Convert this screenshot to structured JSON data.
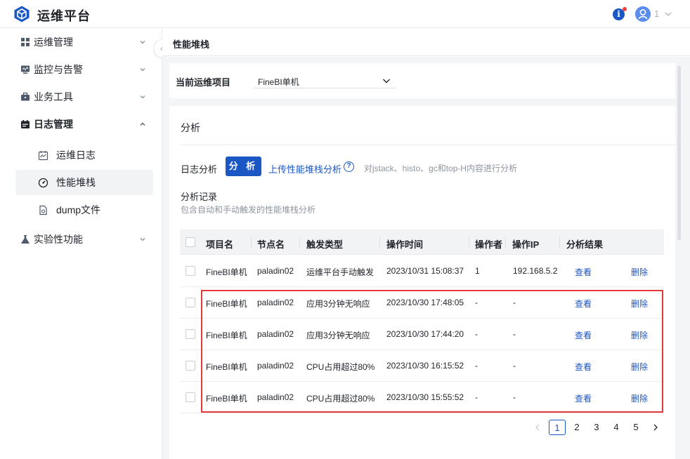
{
  "header": {
    "app_title": "运维平台",
    "logo_icon": "cube-logo-icon",
    "user_name": "1",
    "accent": "#1a56c4",
    "notification_color": "#f53f3f"
  },
  "sidebar": {
    "items": [
      {
        "label": "运维管理",
        "icon": "grid-icon",
        "expanded": false
      },
      {
        "label": "监控与告警",
        "icon": "monitor-icon",
        "expanded": false
      },
      {
        "label": "业务工具",
        "icon": "briefcase-icon",
        "expanded": false
      },
      {
        "label": "日志管理",
        "icon": "calendar-icon",
        "expanded": true,
        "children": [
          {
            "label": "运维日志",
            "icon": "log-chart-icon"
          },
          {
            "label": "性能堆栈",
            "icon": "gauge-icon",
            "active": true
          },
          {
            "label": "dump文件",
            "icon": "file-gear-icon"
          }
        ]
      },
      {
        "label": "实验性功能",
        "icon": "flask-icon",
        "expanded": false
      }
    ]
  },
  "breadcrumb": "性能堆栈",
  "project": {
    "label": "当前运维项目",
    "value": "FineBI单机"
  },
  "analysis": {
    "section_title": "分析",
    "log_label": "日志分析",
    "analyze_button": "分 析",
    "upload_link": "上传性能堆栈分析",
    "help_text": "对jstack、histo、gc和top-H内容进行分析",
    "records_title": "分析记录",
    "records_desc": "包含自动和手动触发的性能堆栈分析"
  },
  "table": {
    "columns": [
      "项目名",
      "节点名",
      "触发类型",
      "操作时间",
      "操作者",
      "操作IP",
      "分析结果"
    ],
    "rows": [
      {
        "project": "FineBI单机",
        "node": "paladin02",
        "trigger": "运维平台手动触发",
        "time": "2023/10/31 15:08:37",
        "operator": "1",
        "ip": "192.168.5.2",
        "result": "查看",
        "delete": "删除"
      },
      {
        "project": "FineBI单机",
        "node": "paladin02",
        "trigger": "应用3分钟无响应",
        "time": "2023/10/30 17:48:05",
        "operator": "-",
        "ip": "-",
        "result": "查看",
        "delete": "删除"
      },
      {
        "project": "FineBI单机",
        "node": "paladin02",
        "trigger": "应用3分钟无响应",
        "time": "2023/10/30 17:44:20",
        "operator": "-",
        "ip": "-",
        "result": "查看",
        "delete": "删除"
      },
      {
        "project": "FineBI单机",
        "node": "paladin02",
        "trigger": "CPU占用超过80%",
        "time": "2023/10/30 16:15:52",
        "operator": "-",
        "ip": "-",
        "result": "查看",
        "delete": "删除"
      },
      {
        "project": "FineBI单机",
        "node": "paladin02",
        "trigger": "CPU占用超过80%",
        "time": "2023/10/30 15:55:52",
        "operator": "-",
        "ip": "-",
        "result": "查看",
        "delete": "删除"
      }
    ]
  },
  "pagination": {
    "pages": [
      "1",
      "2",
      "3",
      "4",
      "5"
    ],
    "current": "1"
  }
}
